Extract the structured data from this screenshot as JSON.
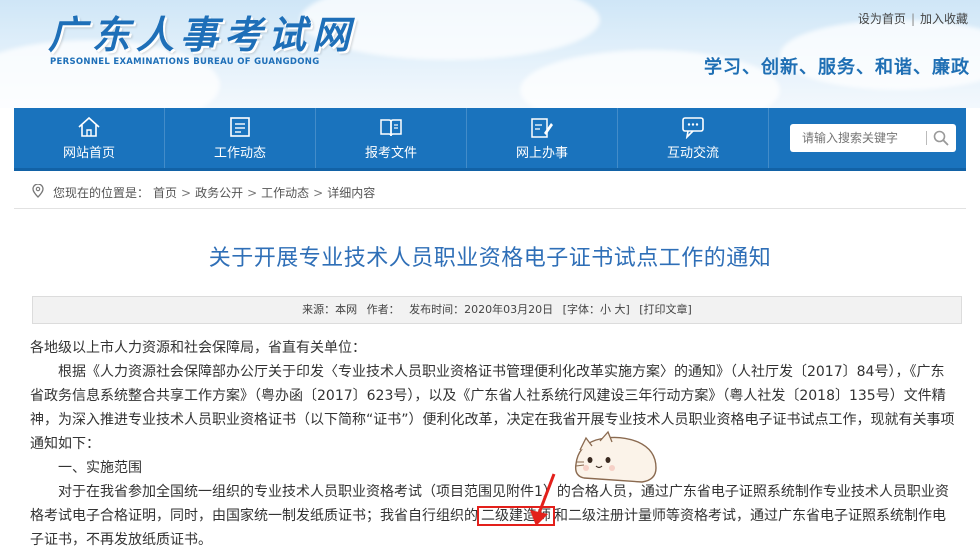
{
  "header": {
    "site_title": "广东人事考试网",
    "site_subtitle": "PERSONNEL EXAMINATIONS BUREAU OF GUANGDONG",
    "top_links": [
      "设为首页",
      "加入收藏"
    ],
    "slogan": "学习、创新、服务、和谐、廉政"
  },
  "nav": {
    "items": [
      {
        "label": "网站首页",
        "icon": "home-icon"
      },
      {
        "label": "工作动态",
        "icon": "news-icon"
      },
      {
        "label": "报考文件",
        "icon": "book-icon"
      },
      {
        "label": "网上办事",
        "icon": "edit-icon"
      },
      {
        "label": "互动交流",
        "icon": "chat-icon"
      }
    ],
    "search_placeholder": "请输入搜索关键字"
  },
  "breadcrumb": {
    "prefix": "您现在的位置是：",
    "items": [
      "首页",
      "政务公开",
      "工作动态",
      "详细内容"
    ]
  },
  "article": {
    "title": "关于开展专业技术人员职业资格电子证书试点工作的通知",
    "meta": {
      "source": "来源：本网",
      "author": "作者：",
      "date": "发布时间：2020年03月20日",
      "font_label": "[字体：",
      "font_small": "小",
      "font_large": "大",
      "font_close": "]",
      "print": "[打印文章]"
    },
    "paragraphs": {
      "p1": "各地级以上市人力资源和社会保障局，省直有关单位：",
      "p2": "根据《人力资源社会保障部办公厅关于印发〈专业技术人员职业资格证书管理便利化改革实施方案〉的通知》（人社厅发〔2017〕84号），《广东省政务信息系统整合共享工作方案》（粤办函〔2017〕623号），以及《广东省人社系统行风建设三年行动方案》（粤人社发〔2018〕135号）文件精神，为深入推进专业技术人员职业资格证书（以下简称“证书”）便利化改革，决定在我省开展专业技术人员职业资格电子证书试点工作，现就有关事项通知如下：",
      "p3": "一、实施范围",
      "p4_a": "对于在我省参加全国统一组织的专业技术人员职业资格考试（项目范围见附件1）的合格人员，通过广东省电子证照系统制作专业技术人员职业资格考试电子合格证明，同时，由国家统一制发纸质证书；我省自行组织的",
      "p4_highlight": "二级建造师",
      "p4_b": "和二级注册计量师等资格考试，通过广东省电子证照系统制作电子证书，不再发放纸质证书。"
    }
  },
  "colors": {
    "brand_blue": "#1a73bd",
    "title_blue": "#2f6fb7",
    "highlight_red": "#e3201b"
  }
}
